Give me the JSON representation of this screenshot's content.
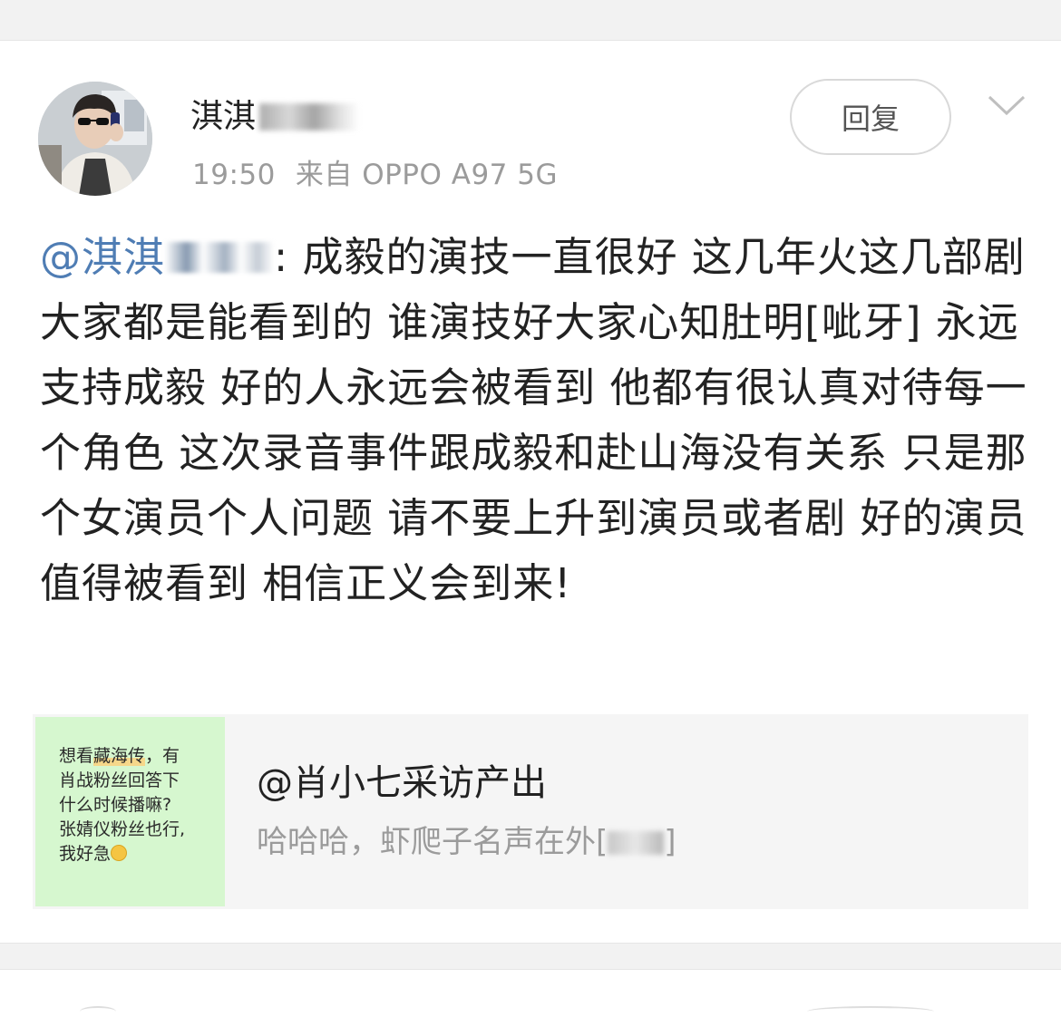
{
  "post": {
    "username": "淇淇",
    "time": "19:50",
    "source": "来自 OPPO A97 5G",
    "reply_label": "回复",
    "mention": "@淇淇",
    "body": ": 成毅的演技一直很好 这几年火这几部剧大家都是能看到的 谁演技好大家心知肚明[呲牙] 永远支持成毅 好的人永远会被看到 他都有很认真对待每一个角色 这次录音事件跟成毅和赴山海没有关系 只是那个女演员个人问题 请不要上升到演员或者剧 好的演员值得被看到 相信正义会到来!"
  },
  "quote": {
    "thumb_line1_pre": "想看",
    "thumb_line1_hl": "藏海传",
    "thumb_line1_post": "，有",
    "thumb_rest": "肖战粉丝回答下\n什么时候播嘛?\n张婧仪粉丝也行,\n我好急",
    "title": "@肖小七采访产出",
    "subtitle": "哈哈哈，虾爬子名声在外["
  },
  "icons": {
    "chevron": "chevron-down-icon",
    "emoji": "smile-emoji-icon"
  },
  "colors": {
    "mention": "#4f7db4",
    "meta": "#9b9b9b",
    "thumb_bg": "#d6f7cf"
  }
}
